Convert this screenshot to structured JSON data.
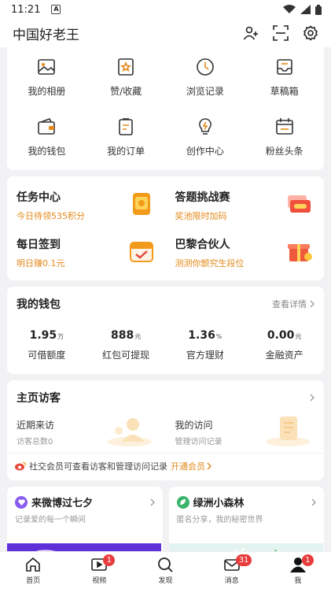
{
  "status_bar": {
    "time": "11:21",
    "notif_letter": "A"
  },
  "header": {
    "title": "中国好老王"
  },
  "grid": [
    {
      "label": "我的相册",
      "icon": "photo-icon"
    },
    {
      "label": "赞/收藏",
      "icon": "star-icon"
    },
    {
      "label": "浏览记录",
      "icon": "clock-icon"
    },
    {
      "label": "草稿箱",
      "icon": "inbox-icon"
    },
    {
      "label": "我的钱包",
      "icon": "wallet-icon"
    },
    {
      "label": "我的订单",
      "icon": "order-icon"
    },
    {
      "label": "创作中心",
      "icon": "bulb-icon"
    },
    {
      "label": "粉丝头条",
      "icon": "calendar-icon"
    }
  ],
  "tasks": [
    {
      "title": "任务中心",
      "sub": "今日待领535积分"
    },
    {
      "title": "答题挑战赛",
      "sub": "奖池限时加码"
    },
    {
      "title": "每日签到",
      "sub": "明日赚0.1元"
    },
    {
      "title": "巴黎合伙人",
      "sub": "测测你颤究生段位"
    }
  ],
  "wallet": {
    "title": "我的钱包",
    "more": "查看详情",
    "items": [
      {
        "value": "1.95",
        "unit": "万",
        "label": "可借额度"
      },
      {
        "value": "888",
        "unit": "元",
        "label": "红包可提现"
      },
      {
        "value": "1.36",
        "unit": "%",
        "label": "官方理财"
      },
      {
        "value": "0.00",
        "unit": "元",
        "label": "金融资产"
      }
    ]
  },
  "visitors": {
    "title": "主页访客",
    "left": {
      "title": "近期来访",
      "sub": "访客总数0"
    },
    "right": {
      "title": "我的访问",
      "sub": "管理访问记录"
    },
    "footer": {
      "text": "社交会员可查看访客和管理访问记录",
      "link": "开通会员"
    }
  },
  "features": [
    {
      "title": "来微博过七夕",
      "sub": "记录爱的每一个瞬间",
      "badge_color": "#8a5cf0"
    },
    {
      "title": "绿洲小森林",
      "sub": "匿名分享，我的秘密世界",
      "badge_color": "#3bb56b"
    }
  ],
  "bottom_nav": [
    {
      "label": "首页",
      "icon": "home-icon",
      "count": ""
    },
    {
      "label": "视频",
      "icon": "video-icon",
      "count": "1"
    },
    {
      "label": "发现",
      "icon": "search-icon",
      "count": ""
    },
    {
      "label": "消息",
      "icon": "mail-icon",
      "count": "31"
    },
    {
      "label": "我",
      "icon": "profile-icon",
      "count": "1"
    }
  ],
  "colors": {
    "accent": "#e48a1c",
    "badge": "#e83b3b"
  }
}
